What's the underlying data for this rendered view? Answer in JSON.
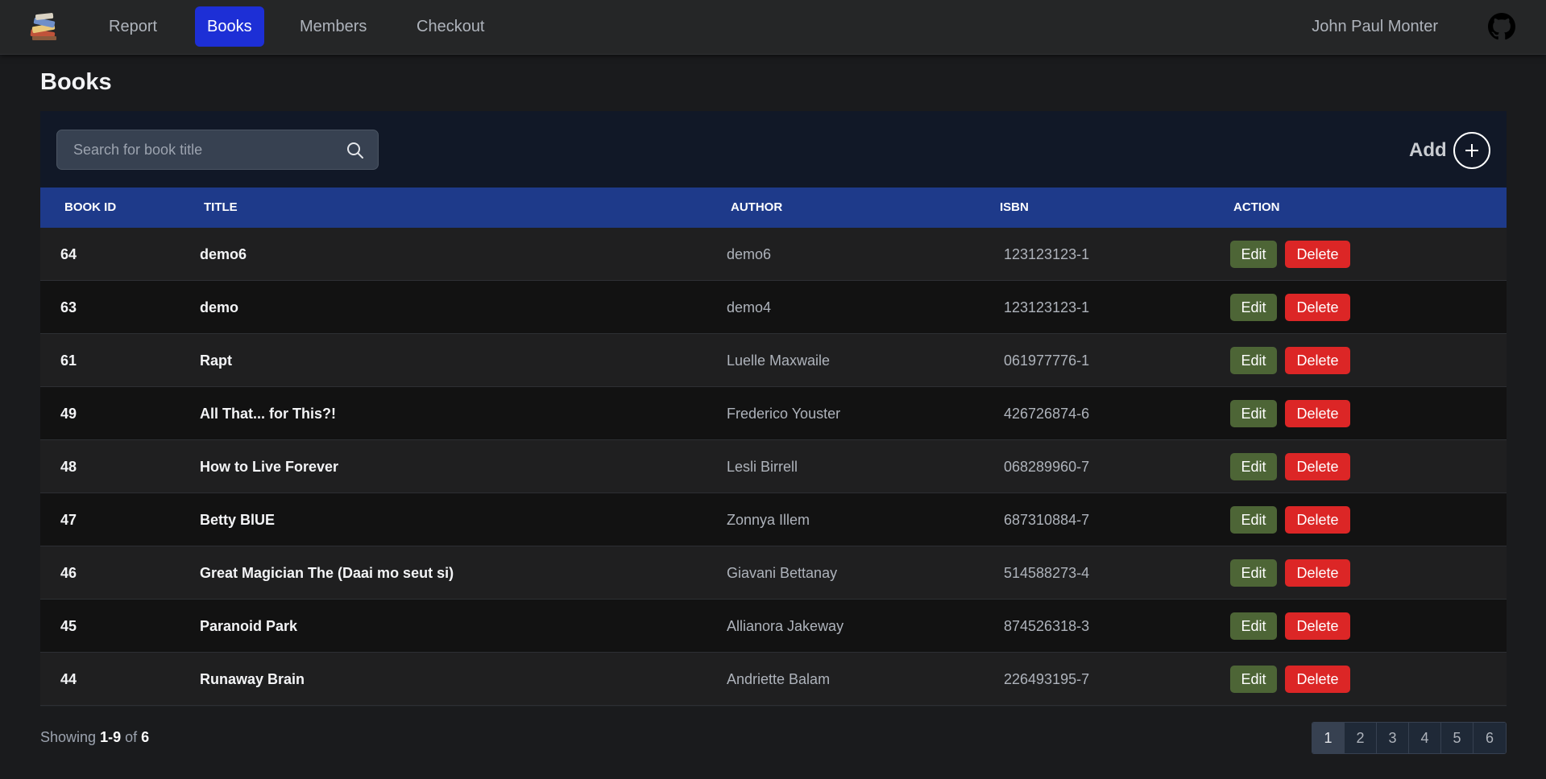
{
  "nav": {
    "logo_icon": "books-stack-icon",
    "links": [
      {
        "label": "Report",
        "active": false
      },
      {
        "label": "Books",
        "active": true
      },
      {
        "label": "Members",
        "active": false
      },
      {
        "label": "Checkout",
        "active": false
      }
    ],
    "user_name": "John Paul Monter",
    "github_icon": "github-icon"
  },
  "page": {
    "title": "Books"
  },
  "search": {
    "placeholder": "Search for book title",
    "value": "",
    "icon": "search-icon"
  },
  "add": {
    "label": "Add",
    "icon": "plus-circle-icon"
  },
  "table": {
    "columns": [
      "Book ID",
      "Title",
      "Author",
      "ISBN",
      "Action"
    ],
    "edit_label": "Edit",
    "delete_label": "Delete",
    "rows": [
      {
        "id": "64",
        "title": "demo6",
        "author": "demo6",
        "isbn": "123123123-1"
      },
      {
        "id": "63",
        "title": "demo",
        "author": "demo4",
        "isbn": "123123123-1"
      },
      {
        "id": "61",
        "title": "Rapt",
        "author": "Luelle Maxwaile",
        "isbn": "061977776-1"
      },
      {
        "id": "49",
        "title": "All That... for This?!",
        "author": "Frederico Youster",
        "isbn": "426726874-6"
      },
      {
        "id": "48",
        "title": "How to Live Forever",
        "author": "Lesli Birrell",
        "isbn": "068289960-7"
      },
      {
        "id": "47",
        "title": "Betty BlUE",
        "author": "Zonnya Illem",
        "isbn": "687310884-7"
      },
      {
        "id": "46",
        "title": "Great Magician The (Daai mo seut si)",
        "author": "Giavani Bettanay",
        "isbn": "514588273-4"
      },
      {
        "id": "45",
        "title": "Paranoid Park",
        "author": "Allianora Jakeway",
        "isbn": "874526318-3"
      },
      {
        "id": "44",
        "title": "Runaway Brain",
        "author": "Andriette Balam",
        "isbn": "226493195-7"
      }
    ]
  },
  "footer": {
    "showing_prefix": "Showing",
    "range": "1-9",
    "of_word": "of",
    "total": "6",
    "pages": [
      "1",
      "2",
      "3",
      "4",
      "5",
      "6"
    ],
    "current_page": "1"
  },
  "colors": {
    "nav_active": "#1d2fd6",
    "table_header": "#1e3a8a",
    "edit_button": "#4d6536",
    "delete_button": "#dc2626",
    "toolbar_bg": "#111827"
  }
}
